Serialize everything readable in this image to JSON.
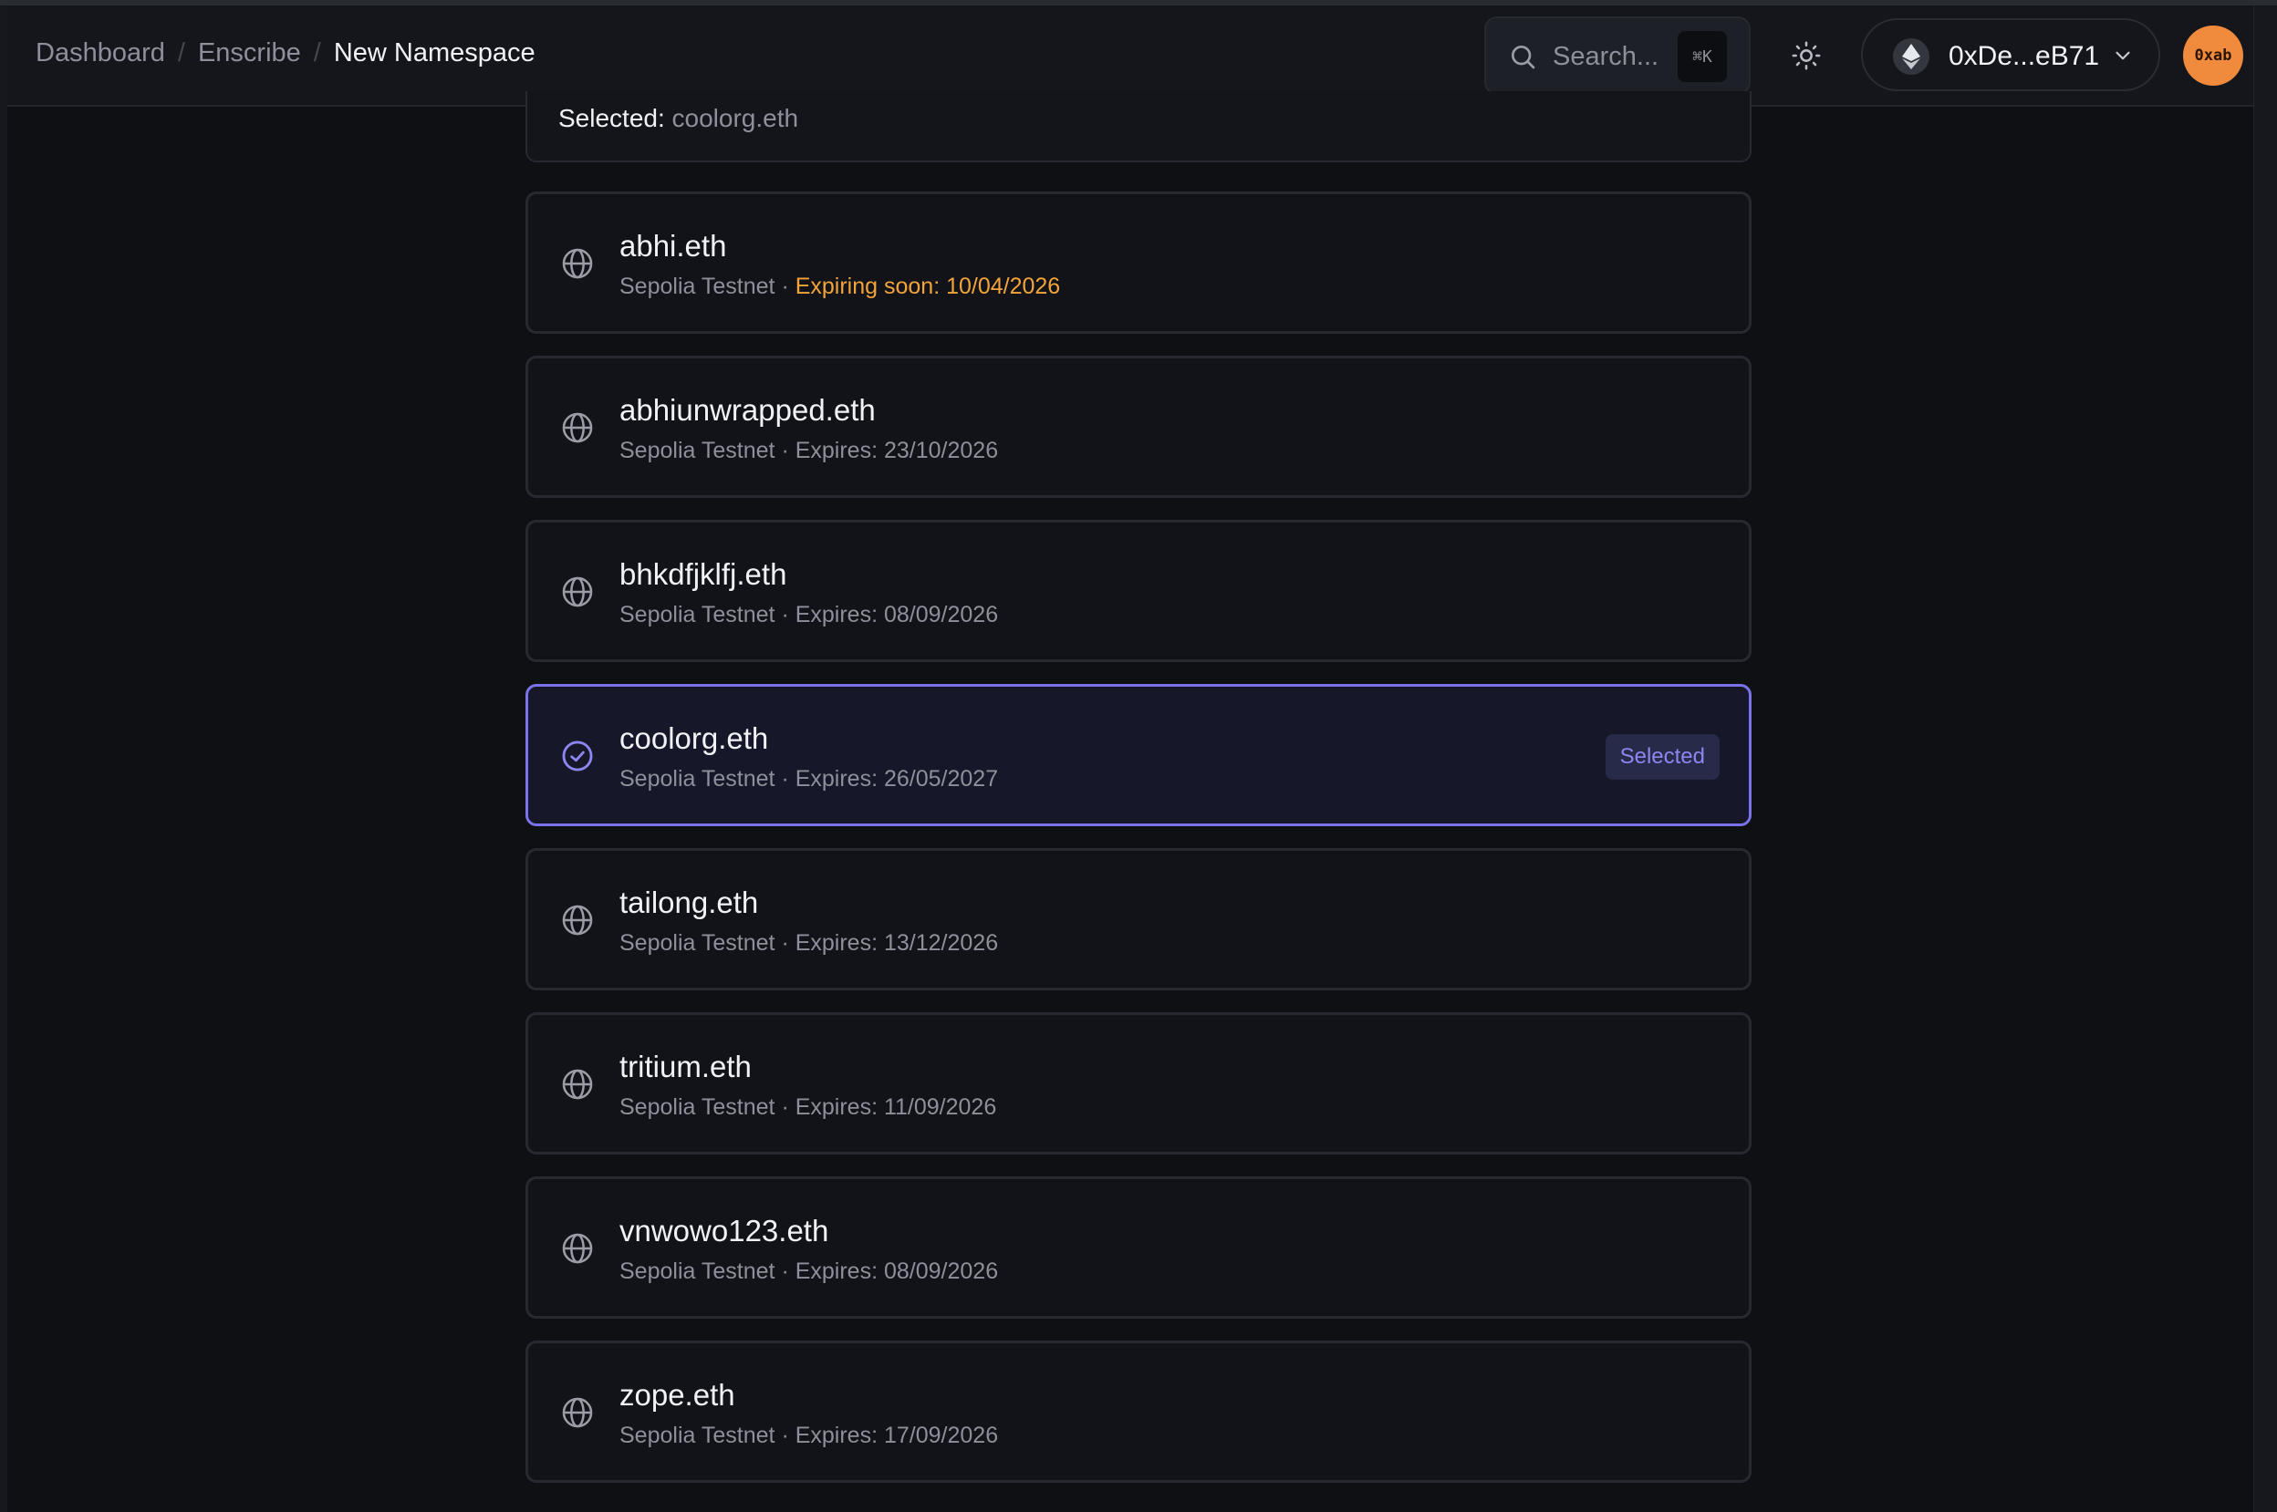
{
  "breadcrumb": {
    "items": [
      "Dashboard",
      "Enscribe"
    ],
    "current": "New Namespace"
  },
  "search": {
    "placeholder": "Search...",
    "shortcut": "⌘K"
  },
  "wallet": {
    "address": "0xDe...eB71"
  },
  "avatar": {
    "label": "0xab",
    "color": "#f08a3c"
  },
  "summary": {
    "label": "Selected:",
    "value": "coolorg.eth"
  },
  "selected_badge": "Selected",
  "colors": {
    "accent": "#7b72ea",
    "warning": "#f2a43a"
  },
  "namespaces": [
    {
      "name": "abhi.eth",
      "network": "Sepolia Testnet",
      "sep": " · ",
      "expiry": "Expiring soon: 10/04/2026",
      "warning": true,
      "selected": false
    },
    {
      "name": "abhiunwrapped.eth",
      "network": "Sepolia Testnet",
      "sep": " · ",
      "expiry": "Expires: 23/10/2026",
      "warning": false,
      "selected": false
    },
    {
      "name": "bhkdfjklfj.eth",
      "network": "Sepolia Testnet",
      "sep": " · ",
      "expiry": "Expires: 08/09/2026",
      "warning": false,
      "selected": false
    },
    {
      "name": "coolorg.eth",
      "network": "Sepolia Testnet",
      "sep": " · ",
      "expiry": "Expires: 26/05/2027",
      "warning": false,
      "selected": true
    },
    {
      "name": "tailong.eth",
      "network": "Sepolia Testnet",
      "sep": " · ",
      "expiry": "Expires: 13/12/2026",
      "warning": false,
      "selected": false
    },
    {
      "name": "tritium.eth",
      "network": "Sepolia Testnet",
      "sep": " · ",
      "expiry": "Expires: 11/09/2026",
      "warning": false,
      "selected": false
    },
    {
      "name": "vnwowo123.eth",
      "network": "Sepolia Testnet",
      "sep": " · ",
      "expiry": "Expires: 08/09/2026",
      "warning": false,
      "selected": false
    },
    {
      "name": "zope.eth",
      "network": "Sepolia Testnet",
      "sep": " · ",
      "expiry": "Expires: 17/09/2026",
      "warning": false,
      "selected": false
    }
  ]
}
